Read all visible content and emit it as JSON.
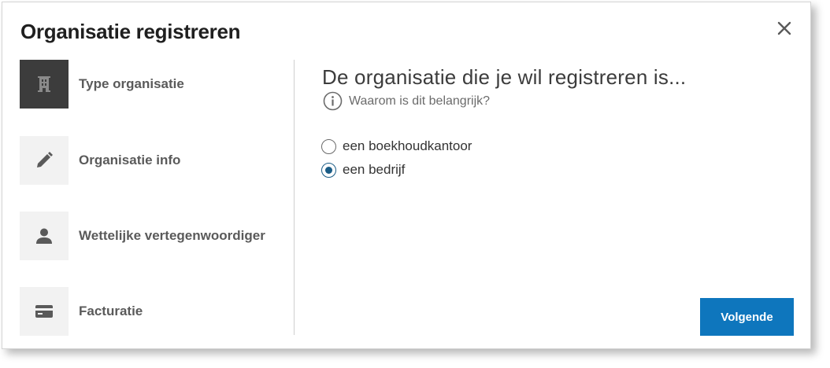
{
  "dialog": {
    "title": "Organisatie registreren",
    "close_icon": "close-icon"
  },
  "steps": [
    {
      "label": "Type organisatie",
      "icon": "building-icon",
      "active": true
    },
    {
      "label": "Organisatie info",
      "icon": "pencil-icon",
      "active": false
    },
    {
      "label": "Wettelijke vertegenwoordiger",
      "icon": "person-icon",
      "active": false
    },
    {
      "label": "Facturatie",
      "icon": "credit-card-icon",
      "active": false
    }
  ],
  "main": {
    "question": "De organisatie die je wil registreren is...",
    "info_link": "Waarom is dit belangrijk?",
    "info_icon": "info-icon",
    "options": [
      {
        "label": "een boekhoudkantoor",
        "checked": false
      },
      {
        "label": "een bedrijf",
        "checked": true
      }
    ],
    "next_label": "Volgende"
  },
  "colors": {
    "accent": "#0e76bd",
    "radio_checked": "#1a5c86",
    "active_step": "#3c3c3c",
    "inactive_step": "#f2f2f2"
  }
}
